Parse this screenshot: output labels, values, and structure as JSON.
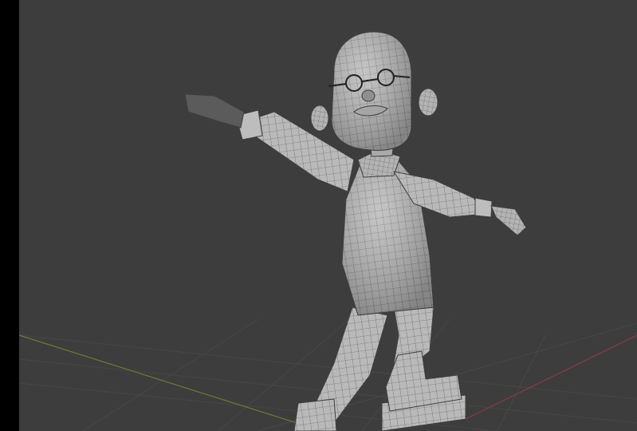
{
  "app": {
    "context": "3D viewport",
    "shading": "solid-wireframe"
  },
  "viewport": {
    "background_color": "#3d3d3d",
    "grid_color": "#4a4a4a",
    "x_axis_color": "#8a3a46",
    "y_axis_color": "#6d7a37"
  },
  "model": {
    "kind": "character-mesh",
    "surface_color": "#b9b9b9",
    "wire_color": "#4a4a4a",
    "hand_color": "#5b5b5b"
  }
}
